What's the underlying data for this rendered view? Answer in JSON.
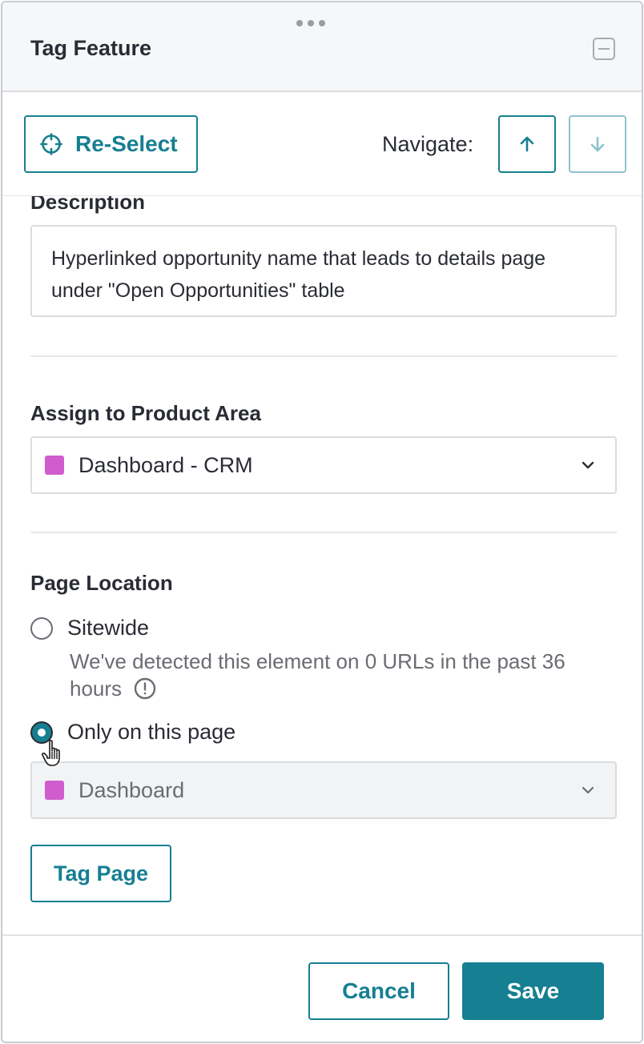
{
  "header": {
    "title": "Tag Feature",
    "drag_icon": "drag-handle-dots-icon",
    "minimize_icon": "minimize-icon"
  },
  "toolbar": {
    "reselect_label": "Re-Select",
    "reselect_icon": "crosshair-icon",
    "navigate_label": "Navigate:",
    "up_icon": "arrow-up-icon",
    "down_icon": "arrow-down-icon"
  },
  "description": {
    "label": "Description",
    "value": "Hyperlinked opportunity name that leads to details page under \"Open Opportunities\" table"
  },
  "product_area": {
    "label": "Assign to Product Area",
    "selected": "Dashboard - CRM",
    "swatch_color": "#d15ccd"
  },
  "page_location": {
    "label": "Page Location",
    "options": [
      {
        "label": "Sitewide",
        "checked": false
      },
      {
        "label": "Only on this page",
        "checked": true
      }
    ],
    "sitewide_hint": "We've detected this element on 0 URLs in the past 36 hours",
    "page_selected": "Dashboard",
    "page_swatch_color": "#d15ccd",
    "tag_page_label": "Tag Page"
  },
  "footer": {
    "cancel_label": "Cancel",
    "save_label": "Save"
  },
  "colors": {
    "accent": "#167f92",
    "text": "#2a2c35",
    "muted": "#6a6c73"
  }
}
